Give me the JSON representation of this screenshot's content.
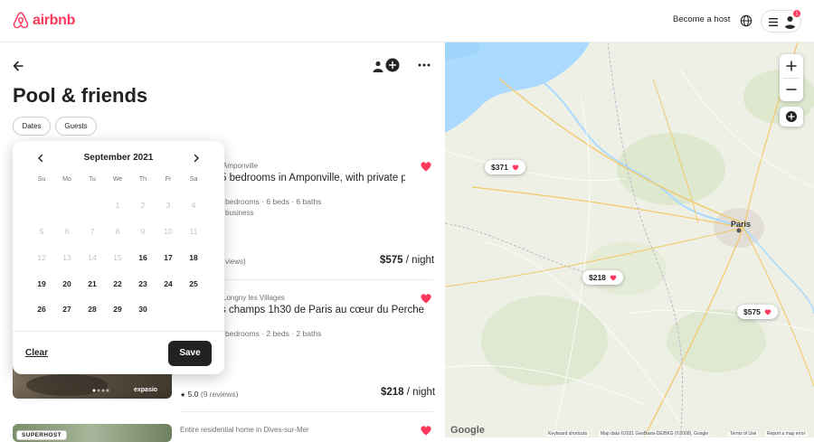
{
  "header": {
    "logo_text": "airbnb",
    "become_host": "Become a host",
    "notification_count": "1",
    "accent_color": "#ff385c"
  },
  "wishlist": {
    "title": "Pool & friends",
    "filters": [
      "Dates",
      "Guests"
    ]
  },
  "calendar": {
    "month_label": "September 2021",
    "weekdays": [
      "Su",
      "Mo",
      "Tu",
      "We",
      "Th",
      "Fr",
      "Sa"
    ],
    "weeks": [
      [
        "",
        "",
        "",
        "1",
        "2",
        "3",
        "4"
      ],
      [
        "5",
        "6",
        "7",
        "8",
        "9",
        "10",
        "11"
      ],
      [
        "12",
        "13",
        "14",
        "15",
        "16",
        "17",
        "18"
      ],
      [
        "19",
        "20",
        "21",
        "22",
        "23",
        "24",
        "25"
      ],
      [
        "26",
        "27",
        "28",
        "29",
        "30",
        "",
        ""
      ]
    ],
    "first_available_day": 16,
    "clear_label": "Clear",
    "save_label": "Save"
  },
  "listings": [
    {
      "location": "Amponville",
      "title": "5 bedrooms in Amponville, with private p",
      "details": "bedrooms · 6 beds · 6 baths",
      "extra": "business",
      "rating": "views)",
      "price": "$575",
      "per_night": "/ night"
    },
    {
      "location": "Longny les Villages",
      "title": "s champs 1h30 de Paris au cœur du Perche",
      "details": "bedrooms · 2 beds · 2 baths",
      "rating_value": "5.0",
      "rating_count": "(9 reviews)",
      "price": "$218",
      "per_night": "/ night",
      "photo_watermark": "expasio"
    },
    {
      "badge": "SUPERHOST",
      "location": "Entire residential home in Dives-sur-Mer"
    }
  ],
  "map": {
    "pins": [
      "$371",
      "$218",
      "$575"
    ],
    "city_label": "Paris",
    "footer": {
      "shortcuts": "Keyboard shortcuts",
      "data": "Map data ©2021 GeoBasis-DE/BKG (©2009), Google",
      "terms": "Terms of Use",
      "report": "Report a map error"
    },
    "google_logo": "Google"
  }
}
